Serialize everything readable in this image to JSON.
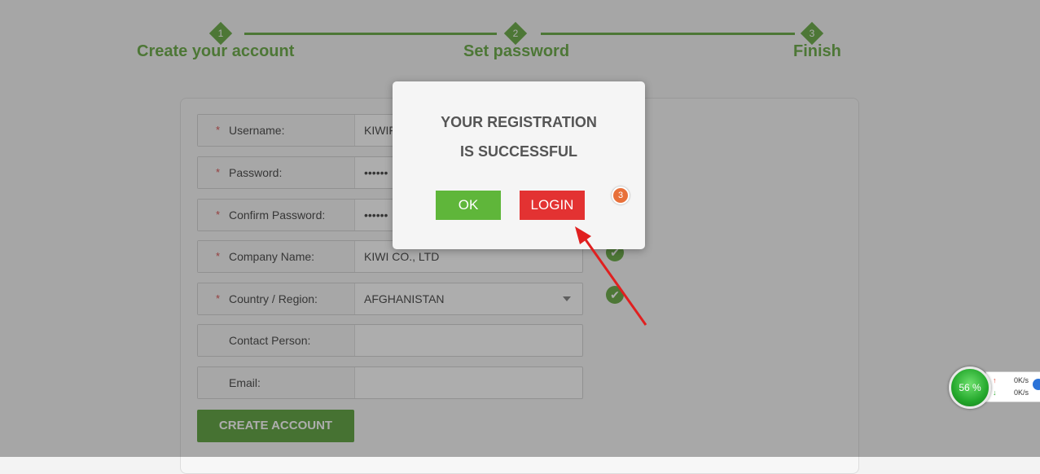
{
  "stepper": {
    "steps": [
      {
        "number": "1",
        "label": "Create your account"
      },
      {
        "number": "2",
        "label": "Set password"
      },
      {
        "number": "3",
        "label": "Finish"
      }
    ]
  },
  "form": {
    "fields": [
      {
        "label": "Username:",
        "required": true,
        "value": "KIWIF"
      },
      {
        "label": "Password:",
        "required": true,
        "value": "••••••"
      },
      {
        "label": "Confirm Password:",
        "required": true,
        "value": "••••••"
      },
      {
        "label": "Company Name:",
        "required": true,
        "value": "KIWI CO., LTD"
      },
      {
        "label": "Country / Region:",
        "required": true,
        "value": "AFGHANISTAN"
      },
      {
        "label": "Contact Person:",
        "required": false,
        "value": ""
      },
      {
        "label": "Email:",
        "required": false,
        "value": ""
      }
    ],
    "required_mark": "*",
    "check_icon": "✔",
    "create_button": "CREATE ACCOUNT"
  },
  "modal": {
    "line1": "YOUR REGISTRATION",
    "line2": "IS SUCCESSFUL",
    "ok_label": "OK",
    "login_label": "LOGIN",
    "badge": "3",
    "annotation_color": "#e02020"
  },
  "net_widget": {
    "percent": "56 %",
    "upload": "0K/s",
    "download": "0K/s",
    "up_arrow": "↑",
    "down_arrow": "↓"
  },
  "colors": {
    "accent_green": "#5aa233",
    "ok_green": "#5fb63a",
    "login_red": "#e33232"
  }
}
